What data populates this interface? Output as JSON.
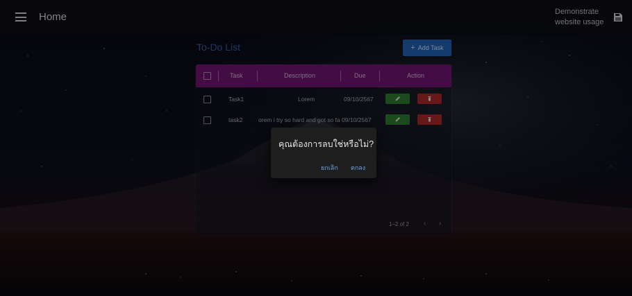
{
  "appbar": {
    "title": "Home",
    "demo_line1": "Demonstrate",
    "demo_line2": "website usage"
  },
  "main": {
    "title": "To-Do List",
    "add_button_label": "Add Task",
    "add_button_icon": "plus-icon"
  },
  "table": {
    "headers": [
      "Task",
      "Description",
      "Due",
      "Action"
    ],
    "rows": [
      {
        "task": "Task1",
        "description": "Lorem",
        "due": "09/10/2567"
      },
      {
        "task": "task2",
        "description": "orem i try so hard and got so fa",
        "due": "09/10/2567"
      }
    ],
    "pagination": "1–2 of 2"
  },
  "dialog": {
    "message": "คุณต้องการลบใช่หรือไม่?",
    "cancel_label": "ยกเลิก",
    "ok_label": "ตกลง"
  },
  "colors": {
    "header_bg": "#6e1470",
    "accent": "#1f5fae",
    "edit": "#2c7a2f",
    "delete": "#a6292a"
  }
}
